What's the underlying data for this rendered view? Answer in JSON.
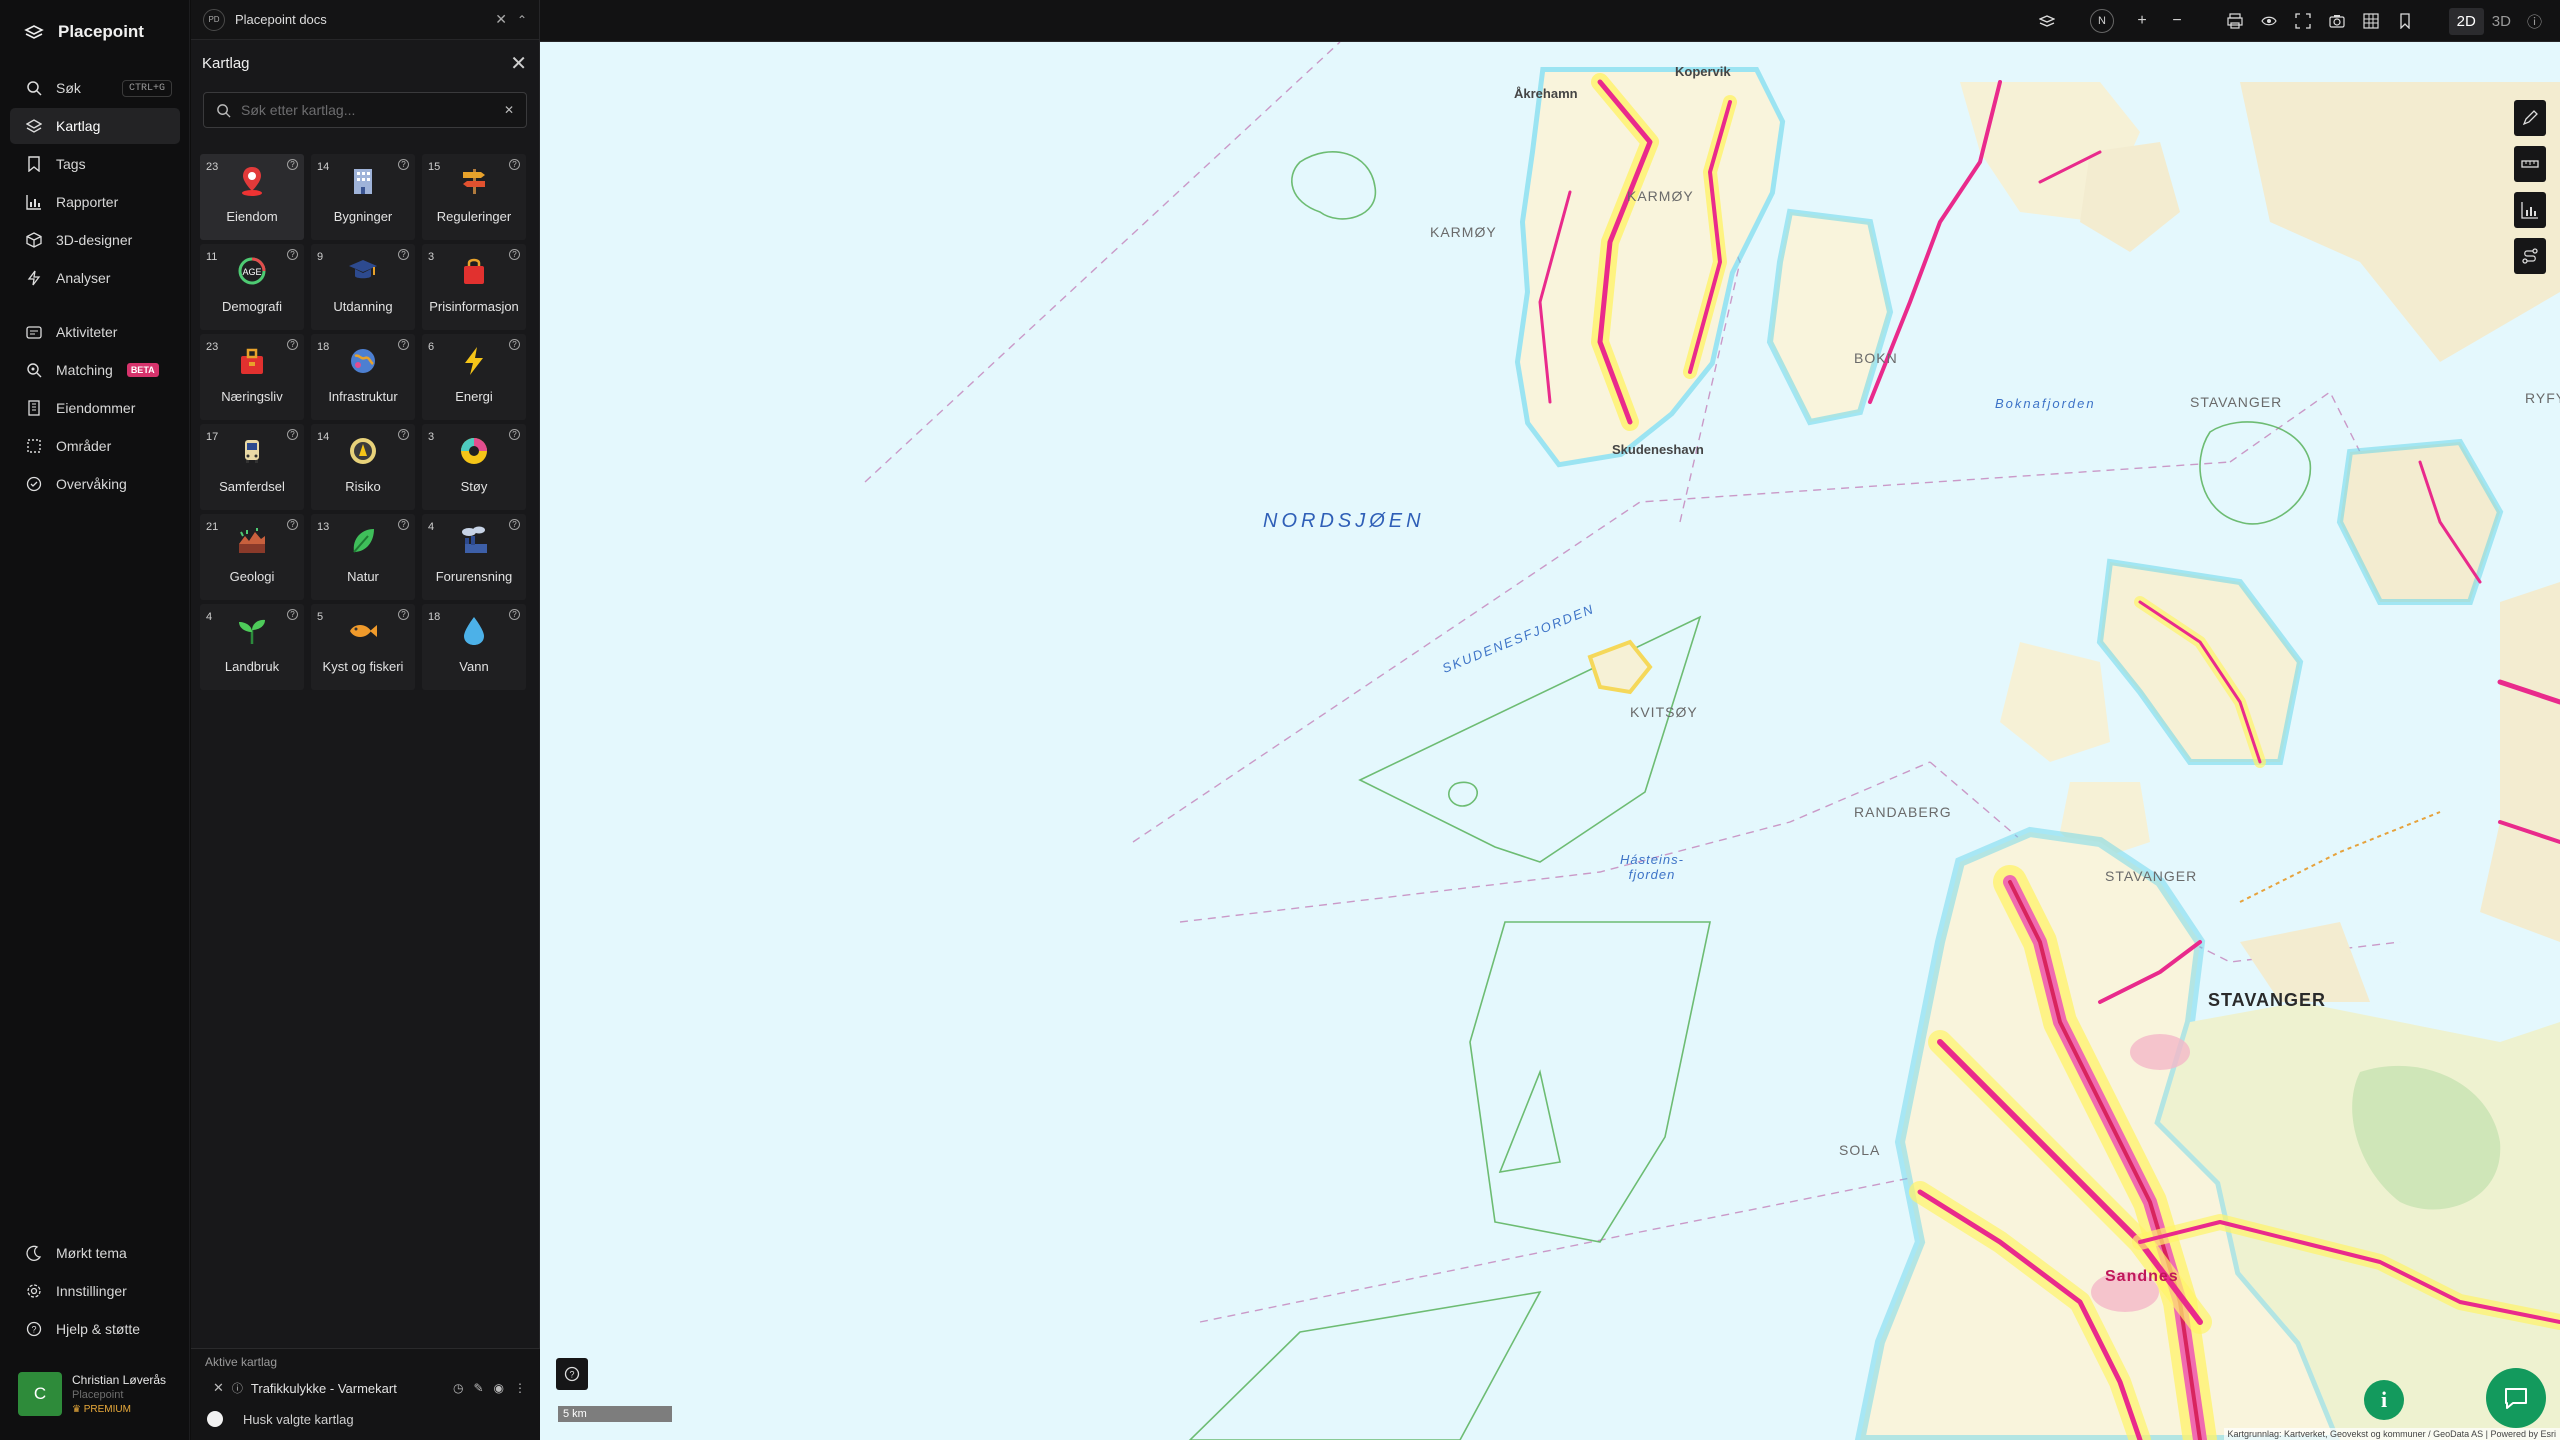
{
  "app": {
    "name": "Placepoint"
  },
  "nav": {
    "items": [
      {
        "label": "Søk",
        "shortcut": "CTRL+G"
      },
      {
        "label": "Kartlag"
      },
      {
        "label": "Tags"
      },
      {
        "label": "Rapporter"
      },
      {
        "label": "3D-designer"
      },
      {
        "label": "Analyser"
      },
      {
        "label": "Aktiviteter"
      },
      {
        "label": "Matching",
        "badge": "BETA"
      },
      {
        "label": "Eiendommer"
      },
      {
        "label": "Områder"
      },
      {
        "label": "Overvåking"
      }
    ],
    "bottom": [
      {
        "label": "Mørkt tema"
      },
      {
        "label": "Innstillinger"
      },
      {
        "label": "Hjelp & støtte"
      }
    ],
    "user": {
      "initial": "C",
      "name": "Christian Løverås",
      "org": "Placepoint",
      "badge": "PREMIUM"
    }
  },
  "tab": {
    "badge": "PD",
    "title": "Placepoint docs"
  },
  "panel": {
    "title": "Kartlag",
    "search_placeholder": "Søk etter kartlag...",
    "categories": [
      {
        "count": "23",
        "label": "Eiendom",
        "icon": "pin-icon"
      },
      {
        "count": "14",
        "label": "Bygninger",
        "icon": "building-icon"
      },
      {
        "count": "15",
        "label": "Reguleringer",
        "icon": "signpost-icon"
      },
      {
        "count": "11",
        "label": "Demografi",
        "icon": "age-gauge-icon"
      },
      {
        "count": "9",
        "label": "Utdanning",
        "icon": "graduation-cap-icon"
      },
      {
        "count": "3",
        "label": "Prisinformasjon",
        "icon": "shopping-bag-icon"
      },
      {
        "count": "23",
        "label": "Næringsliv",
        "icon": "bag-icon"
      },
      {
        "count": "18",
        "label": "Infrastruktur",
        "icon": "globe-icon"
      },
      {
        "count": "6",
        "label": "Energi",
        "icon": "lightning-icon"
      },
      {
        "count": "17",
        "label": "Samferdsel",
        "icon": "bus-icon"
      },
      {
        "count": "14",
        "label": "Risiko",
        "icon": "hazard-icon"
      },
      {
        "count": "3",
        "label": "Støy",
        "icon": "noise-icon"
      },
      {
        "count": "21",
        "label": "Geologi",
        "icon": "terrain-icon"
      },
      {
        "count": "13",
        "label": "Natur",
        "icon": "leaf-icon"
      },
      {
        "count": "4",
        "label": "Forurensning",
        "icon": "factory-icon"
      },
      {
        "count": "4",
        "label": "Landbruk",
        "icon": "sprout-icon"
      },
      {
        "count": "5",
        "label": "Kyst og fiskeri",
        "icon": "fish-icon"
      },
      {
        "count": "18",
        "label": "Vann",
        "icon": "water-drop-icon"
      }
    ],
    "active": {
      "title": "Aktive kartlag",
      "layer": "Trafikkulykke - Varmekart",
      "remember": "Husk valgte kartlag"
    }
  },
  "toolbar": {
    "dim_2d": "2D",
    "dim_3d": "3D",
    "compass": "N"
  },
  "map": {
    "scale": "5 km",
    "attribution": "Kartgrunnlag: Kartverket, Geovekst og kommuner / GeoData AS | Powered by Esri",
    "labels": {
      "nordsjoen": "NORDSJØEN",
      "karmoy_island": "KARMØY",
      "karmoy": "KARMØY",
      "kvitsoy": "KVITSØY",
      "stavanger": "STAVANGER",
      "stavanger_region": "STAVANGER",
      "randaberg": "RANDABERG",
      "sola": "SOLA",
      "sandnes": "Sandnes",
      "bokn": "BOKN",
      "skudenesfjorden": "SKUDENESFJORDEN",
      "boknafjorden": "Boknafjorden",
      "kopervik": "Kopervik",
      "akrehamn": "Åkrehamn",
      "skudeneshavn": "Skudeneshavn",
      "hasteinsfjorden": "Hásteins-fjorden",
      "stavanger_n": "STAVANGER",
      "ryfylke": "RYFYLK"
    }
  }
}
